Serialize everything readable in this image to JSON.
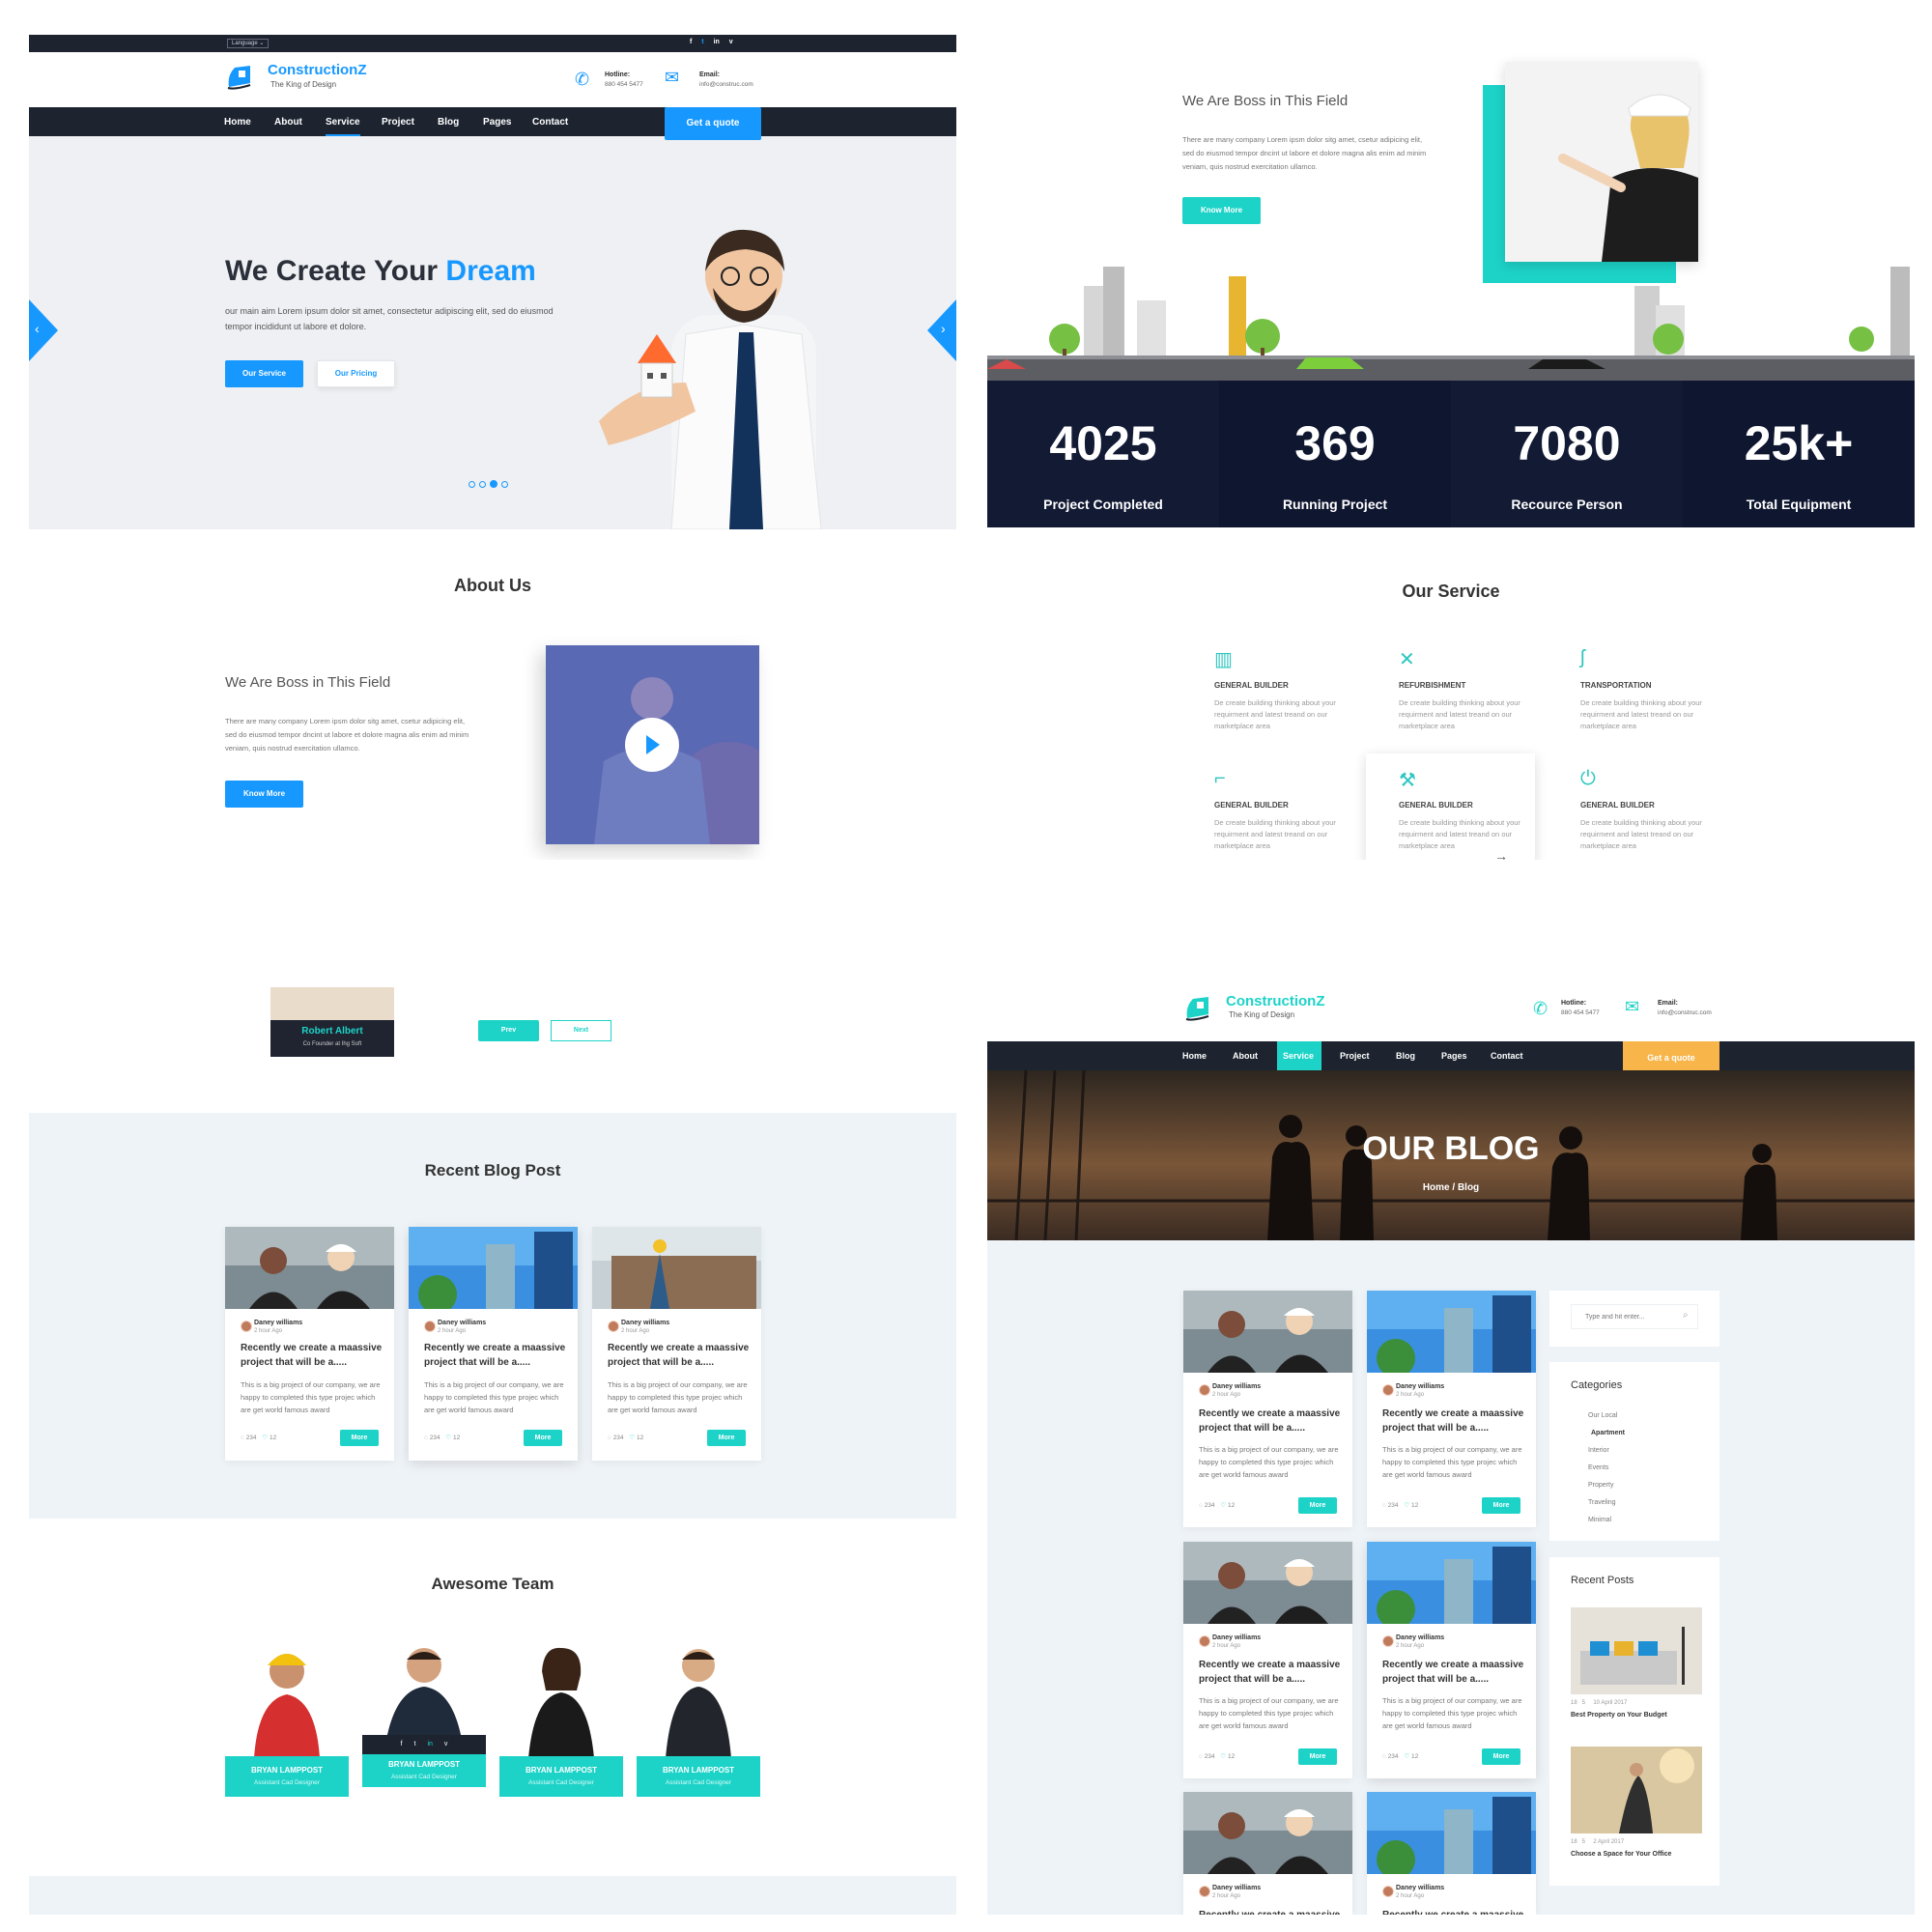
{
  "colors": {
    "teal": "#1dd3c8",
    "blue": "#1798ff",
    "dark_nav": "#1d2430",
    "stats_bg": "#121a34",
    "orange_cta": "#f7b54a"
  },
  "panel1": {
    "topbar": {
      "language": "Language ⌄",
      "social": [
        "f",
        "t",
        "in",
        "v"
      ]
    },
    "logo": {
      "name": "ConstructionZ",
      "tagline": "The King of Design"
    },
    "contact": {
      "hotline_label": "Hotline:",
      "hotline": "880 454 5477",
      "email_label": "Email:",
      "email": "info@construc.com"
    },
    "nav": [
      "Home",
      "About",
      "Service",
      "Project",
      "Blog",
      "Pages",
      "Contact"
    ],
    "nav_active": "Service",
    "cta": "Get a quote",
    "hero": {
      "title_start": "We Create Your",
      "title_accent": "Dream",
      "text": "our main aim Lorem ipsum dolor sit amet, consectetur adipiscing elit, sed do eiusmod tempor incididunt ut labore et dolore.",
      "btn_primary": "Our Service",
      "btn_secondary": "Our Pricing"
    }
  },
  "panel2": {
    "heading": "We Are Boss in This Field",
    "text": "There are many company Lorem ipsm dolor sitg amet, csetur adipicing elit, sed do eiusmod tempor dncint ut labore et dolore magna alis enim ad minim veniam, quis nostrud exercitation ullamco.",
    "button": "Know More",
    "stats": [
      {
        "value": "4025",
        "label": "Project Completed"
      },
      {
        "value": "369",
        "label": "Running Project"
      },
      {
        "value": "7080",
        "label": "Recource Person"
      },
      {
        "value": "25k+",
        "label": "Total Equipment"
      }
    ]
  },
  "panel3": {
    "section_title": "About Us",
    "heading": "We Are Boss in This Field",
    "text": "There are many company Lorem ipsm dolor sitg amet, csetur adipicing elit, sed do eiusmod tempor dncint ut labore et dolore magna alis enim ad minim veniam, quis nostrud exercitation ullamco.",
    "button": "Know More"
  },
  "panel4": {
    "section_title": "Our Service",
    "services": [
      {
        "title": "GENERAL BUILDER",
        "desc": "De create building thinking about your requirment and latest treand on our marketplace area",
        "icon": "building-icon"
      },
      {
        "title": "REFURBISHMENT",
        "desc": "De create building thinking about your requirment and latest treand on our marketplace area",
        "icon": "tools-icon"
      },
      {
        "title": "TRANSPORTATION",
        "desc": "De create building thinking about your requirment and latest treand on our marketplace area",
        "icon": "route-icon"
      },
      {
        "title": "GENERAL BUILDER",
        "desc": "De create building thinking about your requirment and latest treand on our marketplace area",
        "icon": "drill-icon"
      },
      {
        "title": "GENERAL BUILDER",
        "desc": "De create building thinking about your requirment and latest treand on our marketplace area",
        "icon": "crane-icon"
      },
      {
        "title": "GENERAL BUILDER",
        "desc": "De create building thinking about your requirment and latest treand on our marketplace area",
        "icon": "plug-icon"
      }
    ]
  },
  "panel5": {
    "testimonial_name": "Robert Albert",
    "testimonial_role": "Co Founder at Ihg Soft",
    "prev": "Prev",
    "next": "Next",
    "blog_title": "Recent Blog Post",
    "team_title": "Awesome Team",
    "team": [
      {
        "name": "BRYAN LAMPPOST",
        "role": "Assistant Cad Designer"
      },
      {
        "name": "BRYAN LAMPPOST",
        "role": "Assistant Cad Designer"
      },
      {
        "name": "BRYAN LAMPPOST",
        "role": "Assistant Cad Designer"
      },
      {
        "name": "BRYAN LAMPPOST",
        "role": "Assistant Cad Designer"
      }
    ],
    "team_social": [
      "f",
      "t",
      "in",
      "v"
    ]
  },
  "blog_card": {
    "author": "Daney williams",
    "ago": "2 hour Ago",
    "title": "Recently we create a maassive project that will be a.....",
    "excerpt": "This is a big project of our company, we are happy to completed this type projec which are get world  famous award",
    "comments": "234",
    "likes": "12",
    "more": "More"
  },
  "panel6": {
    "logo": {
      "name": "ConstructionZ",
      "tagline": "The King of Design"
    },
    "contact": {
      "hotline_label": "Hotline:",
      "hotline": "880 454 5477",
      "email_label": "Email:",
      "email": "info@construc.com"
    },
    "nav": [
      "Home",
      "About",
      "Service",
      "Project",
      "Blog",
      "Pages",
      "Contact"
    ],
    "nav_active": "Service",
    "cta": "Get a quote",
    "banner_title": "OUR BLOG",
    "breadcrumb": "Home / Blog",
    "search_placeholder": "Type and hit enter...",
    "categories_title": "Categories",
    "categories": [
      "Our Local",
      "Apartment",
      "Interior",
      "Events",
      "Property",
      "Traveling",
      "Minimal"
    ],
    "recent_title": "Recent Posts",
    "recent_posts": [
      {
        "meta": "18   5     10 April 2017",
        "title": "Best Property on Your Budget"
      },
      {
        "meta": "18   5     2 April 2017",
        "title": "Choose a Space for Your Office"
      }
    ]
  }
}
